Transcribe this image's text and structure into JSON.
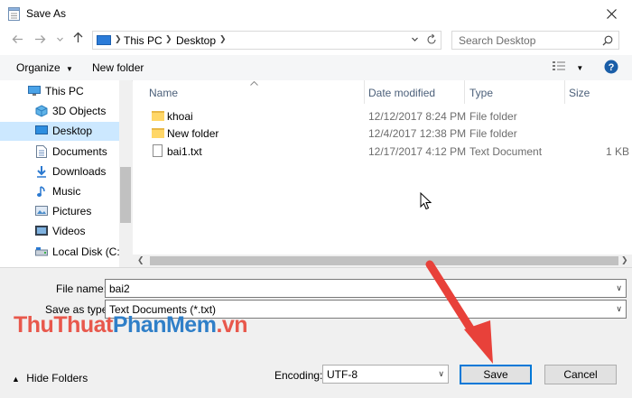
{
  "window": {
    "title": "Save As"
  },
  "breadcrumb": {
    "items": [
      "This PC",
      "Desktop"
    ]
  },
  "search": {
    "placeholder": "Search Desktop"
  },
  "toolbar": {
    "organize_label": "Organize",
    "new_folder_label": "New folder"
  },
  "nav": {
    "items": [
      {
        "label": "This PC",
        "icon": "computer-icon"
      },
      {
        "label": "3D Objects",
        "icon": "cube-icon"
      },
      {
        "label": "Desktop",
        "icon": "desktop-icon",
        "selected": true
      },
      {
        "label": "Documents",
        "icon": "document-icon"
      },
      {
        "label": "Downloads",
        "icon": "download-icon"
      },
      {
        "label": "Music",
        "icon": "music-icon"
      },
      {
        "label": "Pictures",
        "icon": "picture-icon"
      },
      {
        "label": "Videos",
        "icon": "video-icon"
      },
      {
        "label": "Local Disk (C:)",
        "icon": "drive-icon"
      }
    ]
  },
  "columns": {
    "name": "Name",
    "date": "Date modified",
    "type": "Type",
    "size": "Size"
  },
  "files": [
    {
      "name": "khoai",
      "date": "12/12/2017 8:24 PM",
      "type": "File folder",
      "size": "",
      "icon": "folder-icon"
    },
    {
      "name": "New folder",
      "date": "12/4/2017 12:38 PM",
      "type": "File folder",
      "size": "",
      "icon": "folder-icon"
    },
    {
      "name": "bai1.txt",
      "date": "12/17/2017 4:12 PM",
      "type": "Text Document",
      "size": "1 KB",
      "icon": "text-file-icon"
    }
  ],
  "form": {
    "filename_label": "File name:",
    "filename_value": "bai2",
    "savetype_label": "Save as type:",
    "savetype_value": "Text Documents (*.txt)",
    "encoding_label": "Encoding:",
    "encoding_value": "UTF-8"
  },
  "footer": {
    "hide_folders_label": "Hide Folders",
    "save_label": "Save",
    "cancel_label": "Cancel"
  },
  "watermark": {
    "part_a": "ThuThuat",
    "part_b": "PhanMem",
    "part_c": ".vn"
  },
  "colors": {
    "accent": "#0078d7",
    "selection": "#cce8ff",
    "arrow": "#e8413a"
  }
}
